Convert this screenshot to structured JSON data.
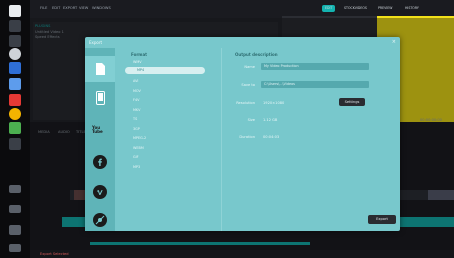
{
  "app": {
    "menu_items": [
      "FILE",
      "EDIT",
      "EXPORT",
      "VIEW",
      "WINDOWS"
    ],
    "project_title": "PLUGINS",
    "project_sub1": "Untitled Video 1",
    "project_sub2": "Speed Effects",
    "header_tabs": [
      "MEDIA",
      "AUDIO",
      "TITLES"
    ],
    "top_right_tabs": [
      "EDIT",
      "STOCKVIDEOS",
      "PREVIEW",
      "HISTORY"
    ],
    "preview_time": "00:00:00:00",
    "status_text": "Export Selected"
  },
  "dialog": {
    "title": "Export",
    "close_glyph": "×",
    "sidebar_icons": [
      "file-icon",
      "device-icon",
      "youtube-icon",
      "facebook-icon",
      "vimeo-icon",
      "disc-icon"
    ],
    "youtube_text": "You Tube",
    "format_header": "Format",
    "formats": [
      "WMV",
      "MP4",
      "AVI",
      "MOV",
      "F4V",
      "MKV",
      "TS",
      "3GP",
      "MPEG-2",
      "WEBM",
      "GIF",
      "MP3"
    ],
    "selected_format_index": 1,
    "output_header": "Output description",
    "name_label": "Name",
    "name_value": "My Video Production",
    "save_to_label": "Save to",
    "save_to_value": "C:\\Users\\...\\Videos",
    "resolution_label": "Resolution",
    "resolution_value": "1920×1080",
    "settings_button": "Settings",
    "size_label": "Size",
    "size_value": "1.12 GB",
    "duration_label": "Duration",
    "duration_value": "00:04:03",
    "export_button": "Export"
  },
  "colors": {
    "dialog_bg": "#78c8cc",
    "accent_teal": "#14b3b0",
    "preview_yellow": "#f2e11a"
  }
}
